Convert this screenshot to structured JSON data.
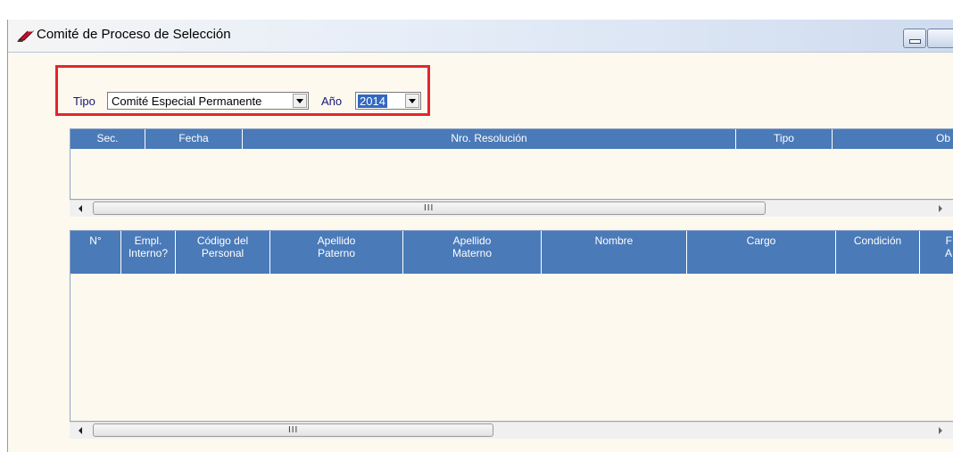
{
  "window": {
    "title": "Comité de Proceso de Selección",
    "icon": "pencil-eraser-icon",
    "buttons": [
      "minimize",
      "maximize"
    ]
  },
  "filters": {
    "tipo_label": "Tipo",
    "tipo_value": "Comité Especial Permanente",
    "anio_label": "Año",
    "anio_value": "2014"
  },
  "grid_comite": {
    "columns": [
      "Sec.",
      "Fecha",
      "Nro. Resolución",
      "Tipo",
      "Ob"
    ],
    "rows": []
  },
  "grid_miembros": {
    "columns": [
      [
        "N°",
        ""
      ],
      [
        "Empl.",
        "Interno?"
      ],
      [
        "Código del",
        "Personal"
      ],
      [
        "Apellido",
        "Paterno"
      ],
      [
        "Apellido",
        "Materno"
      ],
      [
        "Nombre",
        ""
      ],
      [
        "Cargo",
        ""
      ],
      [
        "Condición",
        ""
      ],
      [
        "F",
        "A"
      ]
    ],
    "rows": []
  },
  "scrollbar": {
    "grip": "III"
  },
  "colors": {
    "header_bg": "#4a7ab8",
    "panel_bg": "#fdf9ee",
    "highlight_border": "#e2262c",
    "label_text": "#17177a"
  }
}
